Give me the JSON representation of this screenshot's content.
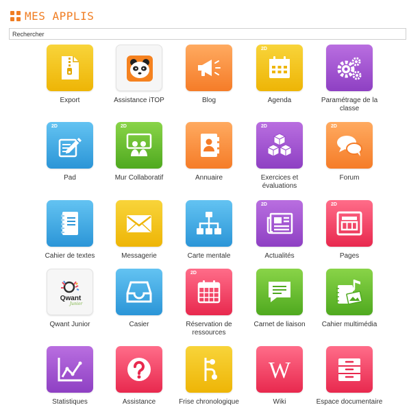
{
  "header": {
    "title": "MES APPLIS"
  },
  "search": {
    "placeholder": "Rechercher"
  },
  "apps": [
    {
      "label": "Export",
      "badge": ""
    },
    {
      "label": "Assistance iTOP",
      "badge": ""
    },
    {
      "label": "Blog",
      "badge": ""
    },
    {
      "label": "Agenda",
      "badge": "2D"
    },
    {
      "label": "Paramétrage de la classe",
      "badge": ""
    },
    {
      "label": "Pad",
      "badge": "2D"
    },
    {
      "label": "Mur Collaboratif",
      "badge": "2D"
    },
    {
      "label": "Annuaire",
      "badge": ""
    },
    {
      "label": "Exercices et évaluations",
      "badge": "2D"
    },
    {
      "label": "Forum",
      "badge": "2D"
    },
    {
      "label": "Cahier de textes",
      "badge": ""
    },
    {
      "label": "Messagerie",
      "badge": ""
    },
    {
      "label": "Carte mentale",
      "badge": ""
    },
    {
      "label": "Actualités",
      "badge": "2D"
    },
    {
      "label": "Pages",
      "badge": "2D"
    },
    {
      "label": "Qwant Junior",
      "badge": "",
      "logo_text": "Qwant",
      "logo_sub": "Junior"
    },
    {
      "label": "Casier",
      "badge": ""
    },
    {
      "label": "Réservation de ressources",
      "badge": "2D"
    },
    {
      "label": "Carnet de liaison",
      "badge": ""
    },
    {
      "label": "Cahier multimédia",
      "badge": ""
    },
    {
      "label": "Statistiques",
      "badge": ""
    },
    {
      "label": "Assistance",
      "badge": ""
    },
    {
      "label": "Frise chronologique",
      "badge": ""
    },
    {
      "label": "Wiki",
      "badge": "",
      "logo_text": "W"
    },
    {
      "label": "Espace documentaire",
      "badge": ""
    }
  ],
  "icons": {
    "header": "apps-grid-icon",
    "tiles": [
      "zip-file-icon",
      "panda-icon",
      "megaphone-icon",
      "calendar-icon",
      "gears-icon",
      "edit-document-icon",
      "collaborative-wall-icon",
      "address-book-icon",
      "cubes-icon",
      "chat-bubbles-icon",
      "notebook-icon",
      "envelope-icon",
      "sitemap-icon",
      "newspaper-icon",
      "page-layout-icon",
      "qwant-logo-icon",
      "inbox-tray-icon",
      "calendar-grid-icon",
      "message-icon",
      "music-image-icon",
      "line-chart-icon",
      "question-icon",
      "timeline-icon",
      "wikipedia-icon",
      "drawers-icon"
    ]
  },
  "colors": {
    "accent": "#f07d22",
    "yellow": "#f2c21c",
    "orange": "#f98e3f",
    "purple": "#a355d3",
    "blue": "#42abe6",
    "green": "#6cc236",
    "red": "#f74466"
  }
}
